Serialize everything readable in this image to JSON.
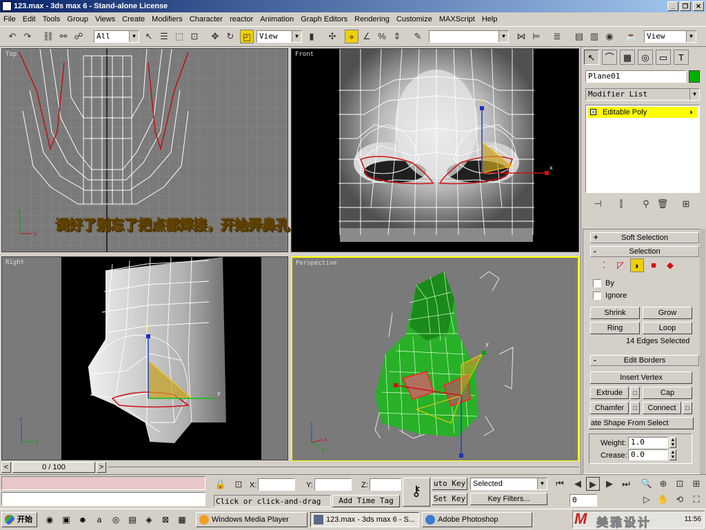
{
  "window": {
    "title": "123.max - 3ds max 6 - Stand-alone License",
    "controls": [
      "_",
      "❐",
      "✕"
    ]
  },
  "menu": [
    "File",
    "Edit",
    "Tools",
    "Group",
    "Views",
    "Create",
    "Modifiers",
    "Character",
    "reactor",
    "Animation",
    "Graph Editors",
    "Rendering",
    "Customize",
    "MAXScript",
    "Help"
  ],
  "toolbar": {
    "selection_filter": "All",
    "ref_coord": "View",
    "named_selection": "",
    "view_combo": "View"
  },
  "viewports": {
    "top": "Top",
    "front": "Front",
    "right": "Right",
    "perspective": "Perspective"
  },
  "axis": {
    "x": "x",
    "y": "y",
    "z": "z"
  },
  "caption": "调好了别忘了把点都焊接，开始弄鼻孔",
  "command_panel": {
    "object_name": "Plane01",
    "object_color": "#00b000",
    "modifier_list": "Modifier List",
    "stack_item": "Editable Poly",
    "rollouts": {
      "soft_selection": "Soft Selection",
      "selection": "Selection",
      "edit_borders": "Edit Borders"
    },
    "checkboxes": {
      "by": "By",
      "ignore": "Ignore"
    },
    "buttons": {
      "shrink": "Shrink",
      "grow": "Grow",
      "ring": "Ring",
      "loop": "Loop",
      "insert_vertex": "Insert Vertex",
      "extrude": "Extrude",
      "cap": "Cap",
      "chamfer": "Chamfer",
      "connect": "Connect",
      "create_shape": "ate Shape From Select"
    },
    "selection_status": "14 Edges Selected",
    "weight_label": "Weight:",
    "weight_value": "1.0",
    "crease_label": "Crease:",
    "crease_value": "0.0"
  },
  "timeline": {
    "frame": "0 / 100",
    "prev": "<",
    "next": ">"
  },
  "status": {
    "x_label": "X:",
    "y_label": "Y:",
    "z_label": "Z:",
    "prompt": "Click or click-and-drag",
    "add_time_tag": "Add Time Tag",
    "auto_key": "uto Key",
    "set_key": "Set Key",
    "selected": "Selected",
    "key_filters": "Key Filters...",
    "frame_value": "0"
  },
  "taskbar": {
    "start": "开始",
    "items": [
      "Windows Media Player",
      "123.max - 3ds max 6 - S...",
      "Adobe Photoshop"
    ],
    "time": "11:56",
    "watermark": "美雅设计"
  }
}
